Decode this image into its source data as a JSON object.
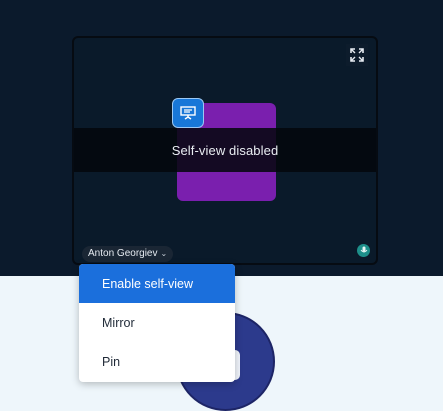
{
  "video_tile": {
    "overlay_text": "Self-view disabled",
    "participant_name": "Anton Georgiev",
    "icons": {
      "fullscreen": "fullscreen-icon",
      "screen_share": "screen-share-icon",
      "name_menu": "chevron-down-icon",
      "microphone": "microphone-icon"
    }
  },
  "context_menu": {
    "items": [
      {
        "label": "Enable self-view",
        "active": true
      },
      {
        "label": "Mirror",
        "active": false
      },
      {
        "label": "Pin",
        "active": false
      }
    ]
  },
  "colors": {
    "background_dark": "#0b1a2c",
    "background_light": "#eef6fb",
    "avatar_purple": "#7a1fae",
    "accent_blue": "#1b6fdc",
    "mic_teal": "#1d8f8a"
  }
}
